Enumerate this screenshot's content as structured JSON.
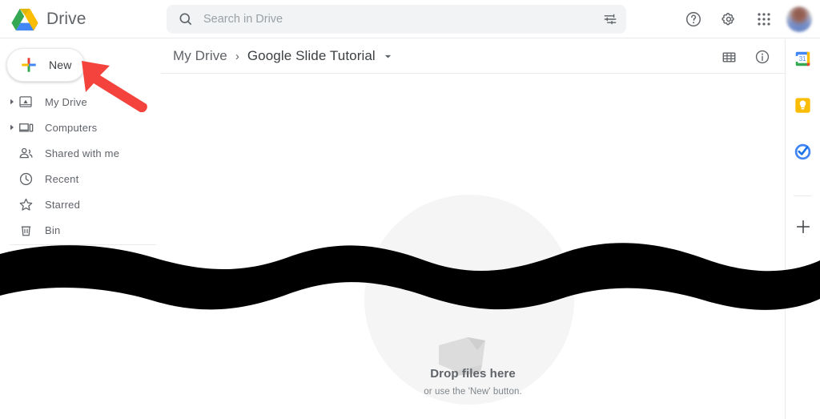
{
  "app": {
    "name": "Drive",
    "logo_icon": "google-drive-logo",
    "colors": {
      "google_blue": "#4285f4",
      "google_red": "#ea4335",
      "google_yellow": "#fbbc04",
      "google_green": "#34a853",
      "text_primary": "#3c4043",
      "text_secondary": "#5f6368",
      "search_bg": "#f1f3f4",
      "divider": "#e8eaed",
      "dropzone_circle": "#f5f5f5",
      "annotation_red": "#f4433d",
      "redaction_black": "#000000"
    }
  },
  "search": {
    "placeholder": "Search in Drive",
    "value": "",
    "search_icon": "search-icon",
    "tune_icon": "tune-options-icon"
  },
  "header_actions": [
    {
      "name": "help",
      "icon": "help-circle-icon"
    },
    {
      "name": "settings",
      "icon": "gear-icon"
    },
    {
      "name": "google-apps",
      "icon": "apps-grid-icon"
    },
    {
      "name": "account",
      "icon": "avatar"
    }
  ],
  "sidebar": {
    "new_button": {
      "label": "New",
      "icon": "plus-icon"
    },
    "items": [
      {
        "label": "My Drive",
        "icon": "my-drive-icon",
        "expandable": true
      },
      {
        "label": "Computers",
        "icon": "computers-icon",
        "expandable": true
      },
      {
        "label": "Shared with me",
        "icon": "shared-with-me-icon",
        "expandable": false
      },
      {
        "label": "Recent",
        "icon": "clock-icon",
        "expandable": false
      },
      {
        "label": "Starred",
        "icon": "star-icon",
        "expandable": false
      },
      {
        "label": "Bin",
        "icon": "trash-icon",
        "expandable": false
      }
    ]
  },
  "breadcrumb": {
    "root": "My Drive",
    "separator": "›",
    "current": "Google Slide Tutorial",
    "caret_icon": "chevron-down-icon"
  },
  "toolbar": [
    {
      "name": "grid-view",
      "icon": "grid-view-icon"
    },
    {
      "name": "details",
      "icon": "info-circle-icon"
    }
  ],
  "dropzone": {
    "title": "Drop files here",
    "subtitle": "or use the 'New' button.",
    "illustration_icon": "document-upload-icon"
  },
  "side_rail": [
    {
      "name": "google-calendar",
      "icon": "calendar-icon"
    },
    {
      "name": "google-keep",
      "icon": "keep-bulb-icon"
    },
    {
      "name": "google-tasks",
      "icon": "tasks-check-icon"
    }
  ],
  "side_rail_add": {
    "name": "add-app",
    "icon": "plus-icon"
  },
  "annotations": {
    "arrow": {
      "icon": "red-arrow-icon",
      "points_to": "New"
    },
    "redaction": {
      "icon": "black-wave-redaction",
      "shape": "wavy-band"
    }
  }
}
